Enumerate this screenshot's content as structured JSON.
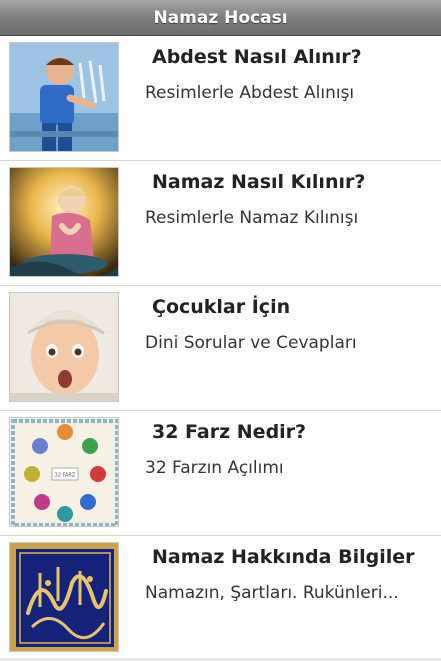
{
  "app": {
    "title": "Namaz Hocası"
  },
  "items": [
    {
      "title": "Abdest Nasıl Alınır?",
      "subtitle": "Resimlerle Abdest Alınışı",
      "image": "boy-washing-ablution-image"
    },
    {
      "title": "Namaz Nasıl Kılınır?",
      "subtitle": "Resimlerle Namaz Kılınışı",
      "image": "child-praying-image"
    },
    {
      "title": "Çocuklar İçin",
      "subtitle": "Dini Sorular ve Cevapları",
      "image": "child-face-image"
    },
    {
      "title": "32 Farz Nedir?",
      "subtitle": "32 Farzın Açılımı",
      "image": "32-farz-diagram-image",
      "image_text": "32 FARZ"
    },
    {
      "title": "Namaz Hakkında Bilgiler",
      "subtitle": "Namazın, Şartları. Rukünleri...",
      "image": "calligraphy-image"
    }
  ],
  "colors": {
    "titlebar": "#7b7b7b",
    "title_text": "#ffffff",
    "divider": "#d6d6d6",
    "row_title": "#222222"
  }
}
